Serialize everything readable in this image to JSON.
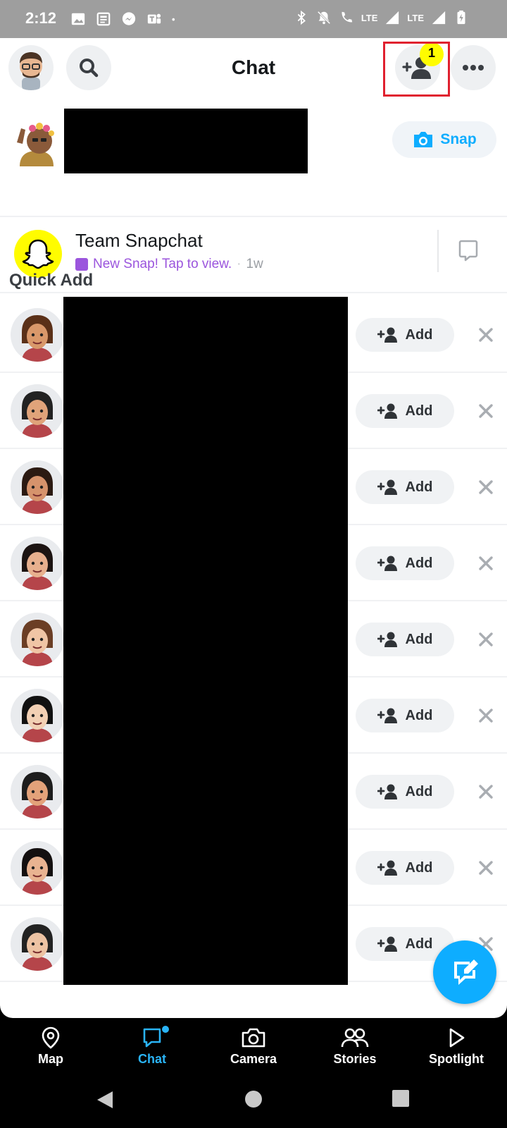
{
  "status_bar": {
    "time": "2:12",
    "network_label": "LTE",
    "network_label_2": "LTE",
    "dot": "•"
  },
  "header": {
    "title": "Chat",
    "friend_request_badge": "1"
  },
  "me_row": {
    "snap_label": "Snap"
  },
  "team_snapchat": {
    "name": "Team Snapchat",
    "status": "New Snap! Tap to view.",
    "separator": "·",
    "time": "1w"
  },
  "quick_add": {
    "title": "Quick Add",
    "add_label": "Add",
    "rows": [
      {
        "avatar": "bitmoji-woman-headband"
      },
      {
        "avatar": "bitmoji-man-sunglasses-horns"
      },
      {
        "avatar": "bitmoji-woman-sunglasses"
      },
      {
        "avatar": "bitmoji-woman-curly-hair"
      },
      {
        "avatar": "bitmoji-woman-glasses"
      },
      {
        "avatar": "bitmoji-man-mask"
      },
      {
        "avatar": "bitmoji-man-sunglasses"
      },
      {
        "avatar": "bitmoji-woman-long-hair"
      },
      {
        "avatar": "bitmoji-man-beard"
      }
    ]
  },
  "bottom_nav": {
    "items": [
      {
        "label": "Map"
      },
      {
        "label": "Chat"
      },
      {
        "label": "Camera"
      },
      {
        "label": "Stories"
      },
      {
        "label": "Spotlight"
      }
    ]
  },
  "colors": {
    "snap_blue": "#0eadff",
    "snap_yellow": "#fffc00",
    "new_snap_purple": "#9b55dd",
    "highlight_red": "#e0202f"
  }
}
